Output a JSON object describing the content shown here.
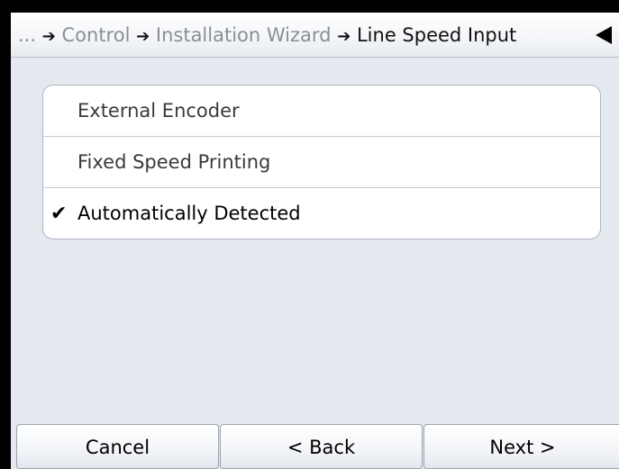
{
  "header": {
    "breadcrumb": [
      {
        "label": "...",
        "current": false
      },
      {
        "label": "Control",
        "current": false
      },
      {
        "label": "Installation Wizard",
        "current": false
      },
      {
        "label": "Line Speed Input",
        "current": true
      }
    ],
    "arrow_glyph": "➔",
    "back_icon": "back-triangle-icon"
  },
  "options": [
    {
      "label": "External Encoder",
      "selected": false
    },
    {
      "label": "Fixed Speed Printing",
      "selected": false
    },
    {
      "label": "Automatically Detected",
      "selected": true
    }
  ],
  "check_glyph": "✔",
  "footer": {
    "cancel_label": "Cancel",
    "back_label": "< Back",
    "next_label": "Next >"
  },
  "colors": {
    "background": "#e4e9f0",
    "inactive_text": "#8a8f96",
    "active_text": "#111111"
  }
}
